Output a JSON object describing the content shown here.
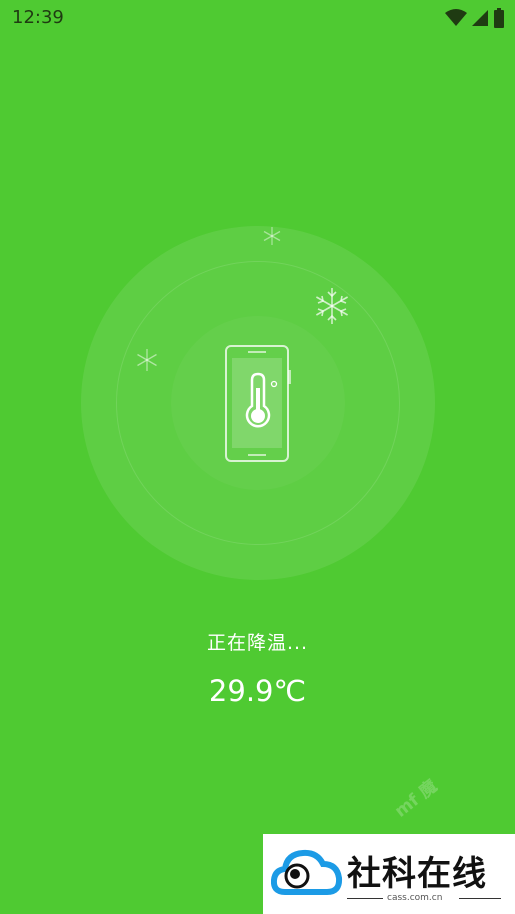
{
  "status_bar": {
    "time": "12:39",
    "icons": [
      "wifi-icon",
      "signal-icon",
      "battery-icon"
    ]
  },
  "cooling": {
    "status_label": "正在降温...",
    "temperature": "29.9℃",
    "icon": "phone-thermometer-icon"
  },
  "watermark": {
    "faint_text": "mf 魔",
    "title": "社科在线",
    "domain": "cass.com.cn"
  },
  "colors": {
    "background": "#4fca32",
    "status_text": "#1f3b12",
    "foreground": "#ffffff"
  }
}
